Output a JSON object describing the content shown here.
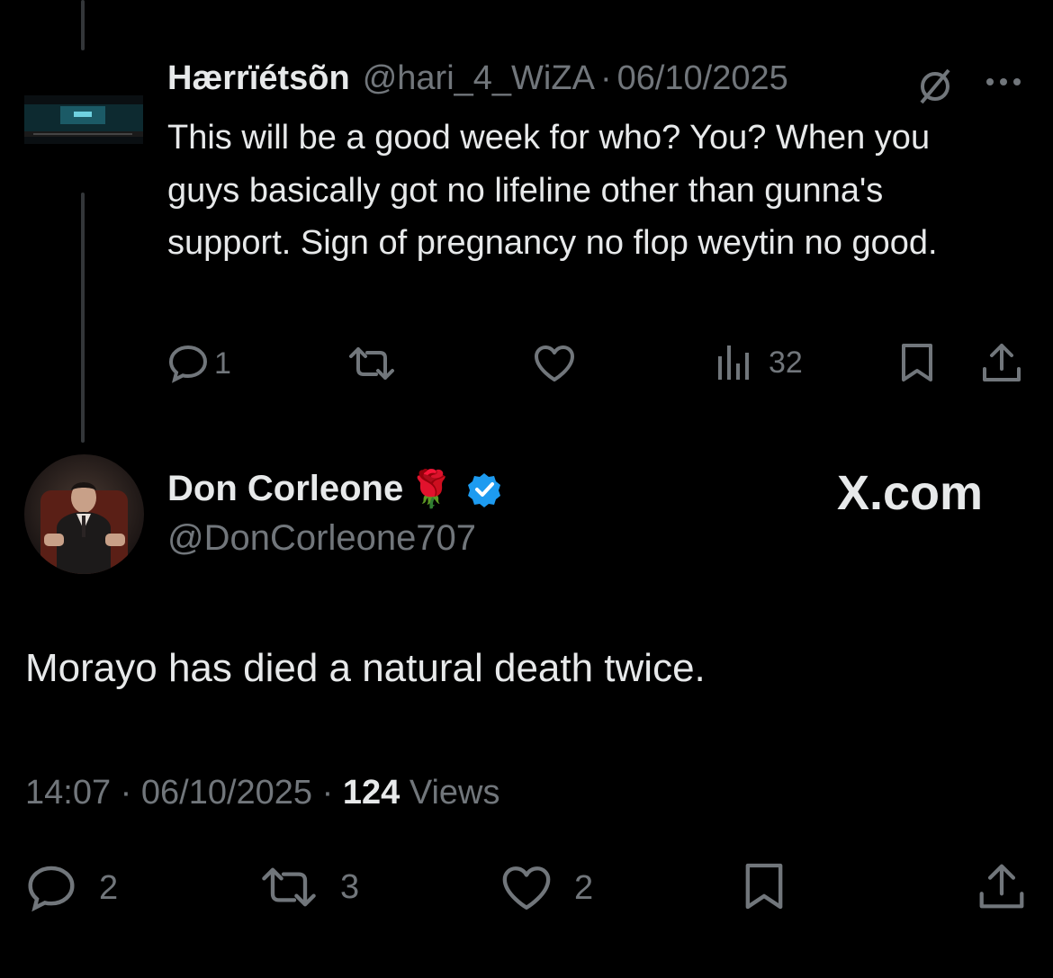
{
  "reply_tweet": {
    "display_name": "Hærrïétsõn",
    "handle": "@hari_4_WiZA",
    "separator": "·",
    "date": "06/10/2025",
    "text": "This will be a good week for who? You? When you guys basically got no lifeline other than gunna's support. Sign of pregnancy no flop weytin no good.",
    "actions": {
      "reply_count": "1",
      "retweet_count": "",
      "like_count": "",
      "views_count": "32"
    }
  },
  "main_tweet": {
    "display_name": "Don Corleone",
    "name_emoji": "🌹",
    "handle": "@DonCorleone707",
    "watermark": "X.com",
    "text": "Morayo has died a natural death twice.",
    "time": "14:07",
    "separator": "·",
    "date": "06/10/2025",
    "views_count": "124",
    "views_label": "Views",
    "actions": {
      "reply_count": "2",
      "retweet_count": "3",
      "like_count": "2"
    }
  },
  "colors": {
    "background": "#000000",
    "text_primary": "#e7e9ea",
    "text_muted": "#71767b",
    "verified_badge": "#1d9bf0",
    "thread_line": "#333639"
  },
  "icons": {
    "reply": "speech-bubble-icon",
    "retweet": "retweet-arrows-icon",
    "like": "heart-icon",
    "views": "bar-chart-icon",
    "bookmark": "bookmark-icon",
    "share": "share-upload-icon",
    "grok": "slashed-circle-icon",
    "more": "ellipsis-icon",
    "verified": "verified-badge-icon"
  }
}
